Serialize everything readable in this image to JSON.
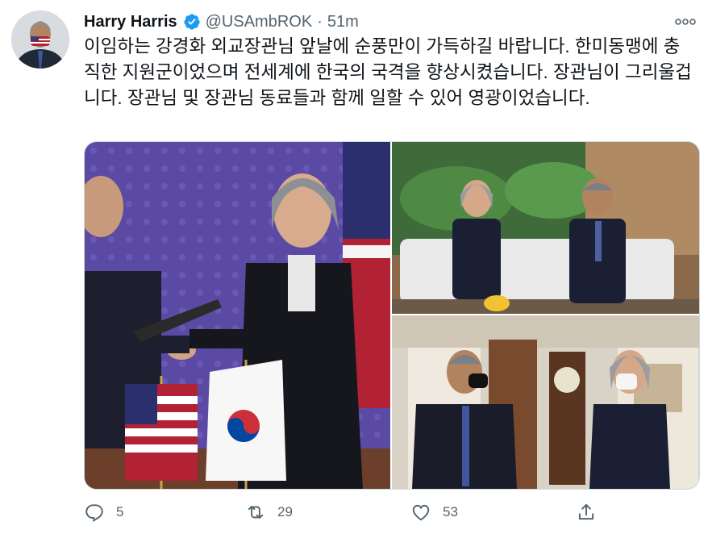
{
  "tweet": {
    "author_name": "Harry Harris",
    "handle": "@USAmbROK",
    "separator": "·",
    "time": "51m",
    "text": "이임하는 강경화 외교장관님 앞날에 순풍만이 가득하길 바랍니다. 한미동맹에 충직한 지원군이었으며 전세계에 한국의 국격을 향상시켰습니다. 장관님이 그리울겁니다. 장관님 및 장관님 동료들과 함께 일할 수 있어 영광이었습니다."
  },
  "actions": {
    "reply_count": "5",
    "retweet_count": "29",
    "like_count": "53"
  },
  "icons": {
    "verified": "verified-badge-icon",
    "more": "more-dots-icon",
    "reply": "reply-icon",
    "retweet": "retweet-icon",
    "like": "heart-icon",
    "share": "share-icon"
  },
  "colors": {
    "verified": "#1d9bf0",
    "secondary_text": "#536471",
    "border": "#cfd9de"
  }
}
